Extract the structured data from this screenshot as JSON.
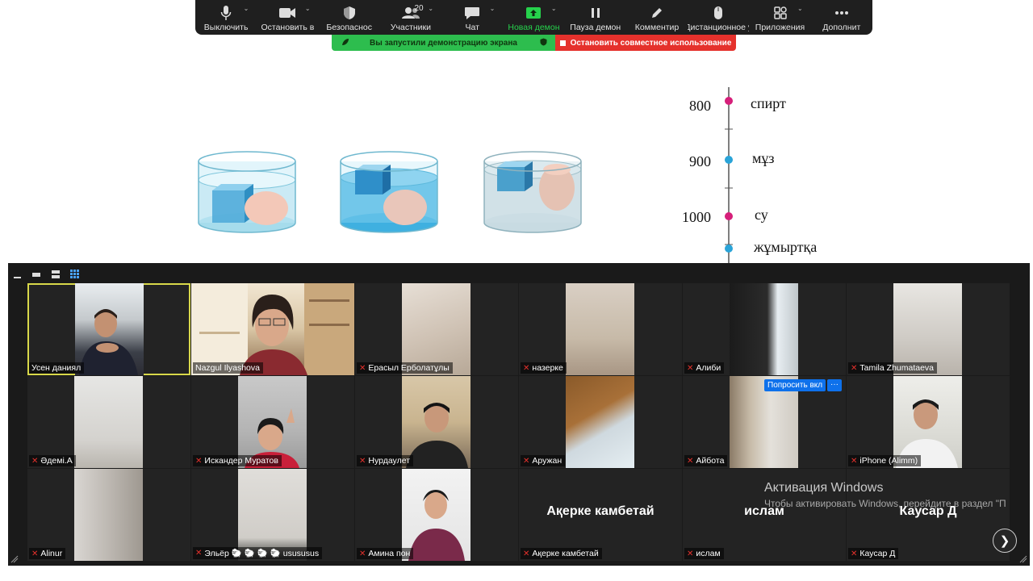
{
  "toolbar": {
    "items": [
      {
        "label": "Выключить",
        "icon": "microphone-icon"
      },
      {
        "label": "Остановить в",
        "icon": "video-camera-icon"
      },
      {
        "label": "Безопаснос",
        "icon": "shield-icon"
      },
      {
        "label": "Участники",
        "icon": "participants-icon",
        "count": "20"
      },
      {
        "label": "Чат",
        "icon": "chat-bubble-icon"
      },
      {
        "label": "Новая демон",
        "icon": "share-screen-icon"
      },
      {
        "label": "Пауза демон",
        "icon": "pause-icon"
      },
      {
        "label": "Комментир",
        "icon": "pencil-icon"
      },
      {
        "label": "Дистанционное у",
        "icon": "mouse-icon"
      },
      {
        "label": "Приложения",
        "icon": "apps-icon"
      },
      {
        "label": "Дополнит",
        "icon": "more-icon"
      }
    ],
    "colors": {
      "active_green": "#26d24c"
    }
  },
  "share_banner": {
    "sharing": "Вы запустили демонстрацию экрана",
    "stop": "Остановить совместное использование"
  },
  "slide": {
    "scale": [
      {
        "value": "800",
        "label": "спирт"
      },
      {
        "value": "900",
        "label": "мұз"
      },
      {
        "value": "1000",
        "label": "су"
      },
      {
        "value": "",
        "label": "жұмыртқа"
      }
    ]
  },
  "gallery": {
    "participants": [
      {
        "name": "Усен даниял",
        "muted": false
      },
      {
        "name": "Nazgul Ilyashova",
        "muted": false
      },
      {
        "name": "Ерасыл Ерболатұлы",
        "muted": true
      },
      {
        "name": "назерке",
        "muted": true
      },
      {
        "name": "Алиби",
        "muted": true
      },
      {
        "name": "Tamila Zhumataeva",
        "muted": true
      },
      {
        "name": "Әдемі.А",
        "muted": true
      },
      {
        "name": "Искандер Муратов",
        "muted": true
      },
      {
        "name": "Нурдаулет",
        "muted": true
      },
      {
        "name": "Аружан",
        "muted": true
      },
      {
        "name": "Айбота",
        "muted": true
      },
      {
        "name": "iPhone (Alimm)",
        "muted": true
      },
      {
        "name": "Alinur",
        "muted": true
      },
      {
        "name": "Эльёр 🐑 🐑 🐑 🐑 usususus",
        "muted": true
      },
      {
        "name": "Амина пон",
        "muted": true
      },
      {
        "name": "Ақерке камбетай",
        "muted": true
      },
      {
        "name": "ислам",
        "muted": true
      },
      {
        "name": "Каусар Д",
        "muted": true
      }
    ],
    "big_names": [
      "Ақерке камбетай",
      "ислам",
      "Каусар Д"
    ],
    "request_button": "Попросить вкл",
    "more_button": "···"
  },
  "windows_watermark": {
    "title": "Активация Windows",
    "subtitle": "Чтобы активировать Windows, перейдите в раздел \"Параметры\"."
  }
}
